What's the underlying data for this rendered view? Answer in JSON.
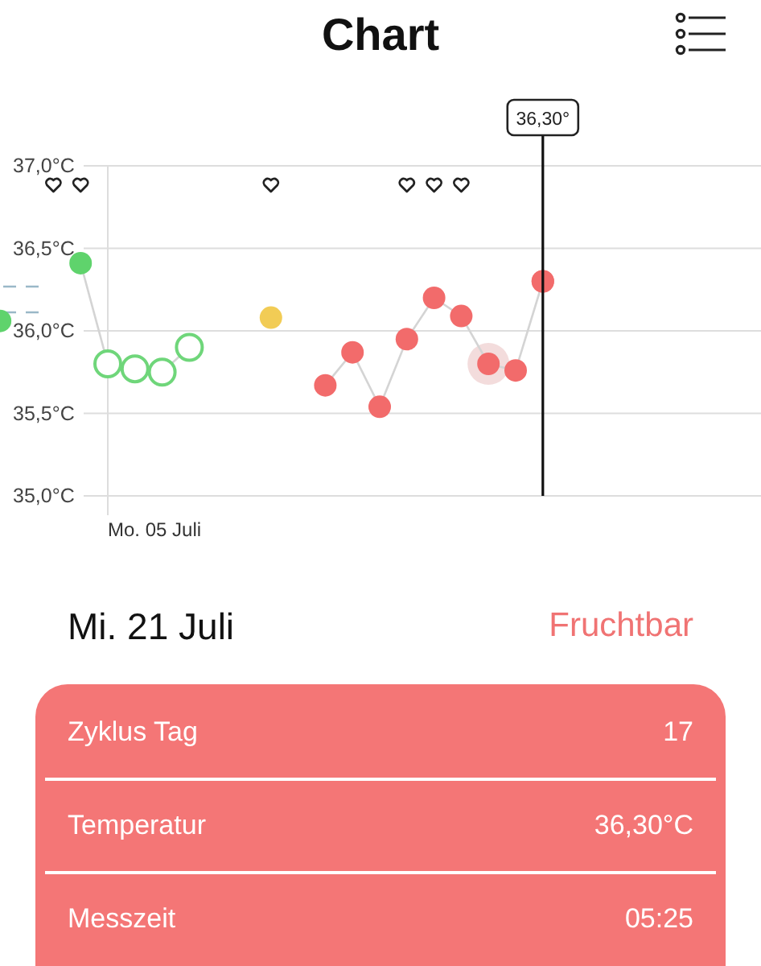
{
  "header": {
    "title": "Chart"
  },
  "chart": {
    "y_labels": [
      "37,0°C",
      "36,5°C",
      "36,0°C",
      "35,5°C",
      "35,0°C"
    ],
    "date_label": "Mo. 05 Juli",
    "tooltip": "36,30°"
  },
  "day": {
    "date": "Mi. 21 Juli",
    "status": "Fruchtbar"
  },
  "details": [
    {
      "label": "Zyklus Tag",
      "value": "17"
    },
    {
      "label": "Temperatur",
      "value": "36,30°C"
    },
    {
      "label": "Messzeit",
      "value": "05:25"
    }
  ]
}
